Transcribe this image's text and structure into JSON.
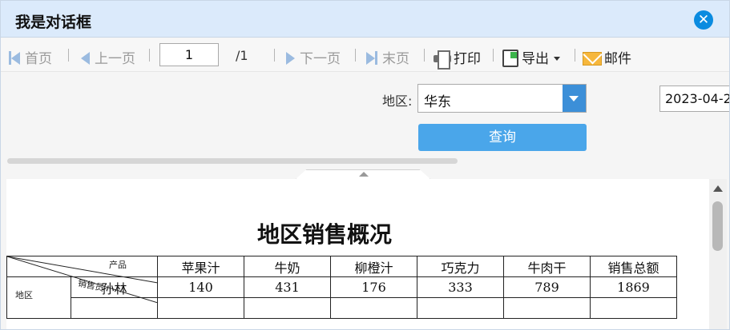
{
  "dialog": {
    "title": "我是对话框"
  },
  "toolbar": {
    "first": "首页",
    "prev": "上一页",
    "page_value": "1",
    "page_total": "/1",
    "next": "下一页",
    "last": "末页",
    "print": "打印",
    "export": "导出",
    "mail": "邮件"
  },
  "params": {
    "region_label": "地区:",
    "region_value": "华东",
    "date_value": "2023-04-2",
    "query_label": "查询"
  },
  "report": {
    "title": "地区销售概况",
    "corner": {
      "product": "产品",
      "salesperson": "销售员",
      "region": "地区"
    },
    "columns": [
      "苹果汁",
      "牛奶",
      "柳橙汁",
      "巧克力",
      "牛肉干",
      "销售总额"
    ],
    "rows": [
      {
        "name": "孙林",
        "values": [
          "140",
          "431",
          "176",
          "333",
          "789",
          "1869"
        ]
      }
    ]
  },
  "colors": {
    "title_bar": "#dbeafb",
    "accent": "#0a8be0",
    "query_button": "#4aa6ea"
  }
}
